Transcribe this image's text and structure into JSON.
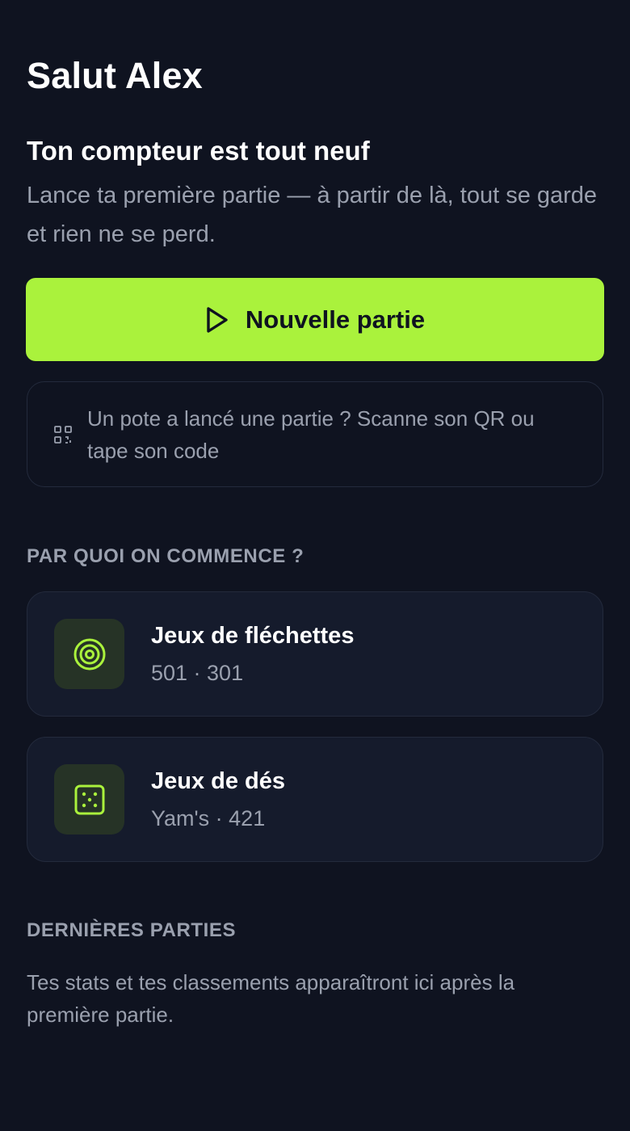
{
  "header": {
    "greeting": "Salut Alex"
  },
  "intro": {
    "headline": "Ton compteur est tout neuf",
    "text": "Lance ta première partie — à partir de là, tout se garde et rien ne se perd."
  },
  "new_game": {
    "label": "Nouvelle partie",
    "icon": "play-icon"
  },
  "join": {
    "text": "Un pote a lancé une partie ? Scanne son QR ou tape son code",
    "icon": "qr-code-icon"
  },
  "start_section": {
    "title": "PAR QUOI ON COMMENCE ?",
    "cards": [
      {
        "title": "Jeux de fléchettes",
        "subtitle": "501 · 301",
        "icon": "target-icon"
      },
      {
        "title": "Jeux de dés",
        "subtitle": "Yam's · 421",
        "icon": "dice-icon"
      }
    ]
  },
  "recent_section": {
    "title": "DERNIÈRES PARTIES",
    "empty_text": "Tes stats et tes classements apparaîtront ici après la première partie."
  },
  "colors": {
    "background": "#0f1320",
    "accent": "#aaf23c",
    "card": "#151b2c",
    "muted_text": "#9aa0ae"
  }
}
